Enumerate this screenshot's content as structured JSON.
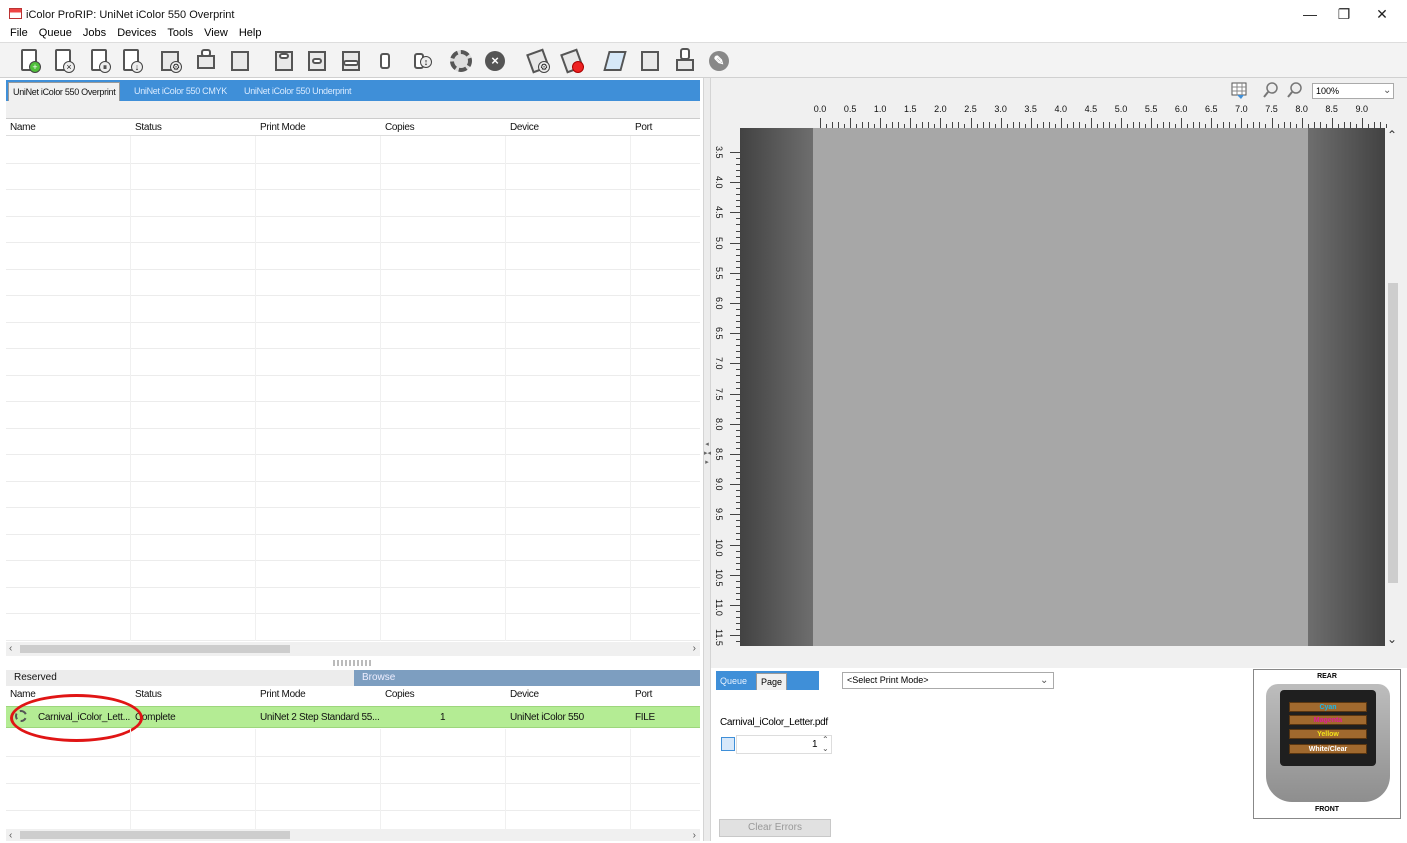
{
  "window": {
    "title": "iColor ProRIP: UniNet iColor 550 Overprint",
    "minimize_glyph": "—",
    "restore_glyph": "❐",
    "close_glyph": "✕"
  },
  "menu": [
    "File",
    "Queue",
    "Jobs",
    "Devices",
    "Tools",
    "View",
    "Help"
  ],
  "toolbar": {
    "icons": [
      "add-file-icon",
      "remove-file-icon",
      "hold-file-icon",
      "release-file-icon",
      "queue-settings-icon",
      "printer-icon",
      "layout-icon",
      "align-top-icon",
      "align-center-icon",
      "align-bottom-icon",
      "rotate-icon",
      "flip-icon",
      "settings-icon",
      "cancel-icon",
      "device-settings-icon",
      "device-stop-icon",
      "send-icon",
      "monitor-icon",
      "print-job-icon",
      "calibrate-icon"
    ]
  },
  "queue_tabs": [
    "UniNet iColor 550 Overprint",
    "UniNet iColor 550 CMYK",
    "UniNet iColor 550 Underprint"
  ],
  "columns": [
    "Name",
    "Status",
    "Print Mode",
    "Copies",
    "Device",
    "Port"
  ],
  "reserved": {
    "label": "Reserved",
    "browse": "Browse"
  },
  "jobs": [
    {
      "name": "Carnival_iColor_Lett...",
      "status": "Complete",
      "print_mode": "UniNet 2 Step Standard 55...",
      "copies": "1",
      "device": "UniNet iColor 550",
      "port": "FILE"
    }
  ],
  "preview": {
    "zoom": "100%",
    "ruler_h": [
      "0.0",
      "0.5",
      "1.0",
      "1.5",
      "2.0",
      "2.5",
      "3.0",
      "3.5",
      "4.0",
      "4.5",
      "5.0",
      "5.5",
      "6.0",
      "6.5",
      "7.0",
      "7.5",
      "8.0",
      "8.5",
      "9.0"
    ],
    "ruler_v": [
      "3.5",
      "4.0",
      "4.5",
      "5.0",
      "5.5",
      "6.0",
      "6.5",
      "7.0",
      "7.5",
      "8.0",
      "8.5",
      "9.0",
      "9.5",
      "10.0",
      "10.5",
      "11.0",
      "11.5"
    ]
  },
  "bottom_right": {
    "tabs": [
      "Queue",
      "Page"
    ],
    "print_mode_placeholder": "<Select Print Mode>",
    "file_name": "Carnival_iColor_Letter.pdf",
    "copies": "1",
    "clear_errors": "Clear Errors"
  },
  "printer_diagram": {
    "rear": "REAR",
    "front": "FRONT",
    "inks": [
      {
        "name": "Cyan",
        "color": "#19b6e8"
      },
      {
        "name": "Magenta",
        "color": "#e0189a"
      },
      {
        "name": "Yellow",
        "color": "#f3e21a"
      },
      {
        "name": "White/Clear",
        "color": "#ffffff"
      }
    ]
  },
  "colors": {
    "tab_blue": "#3f8fd8",
    "selected_row": "#b4ec94",
    "highlight": "#e01515"
  }
}
